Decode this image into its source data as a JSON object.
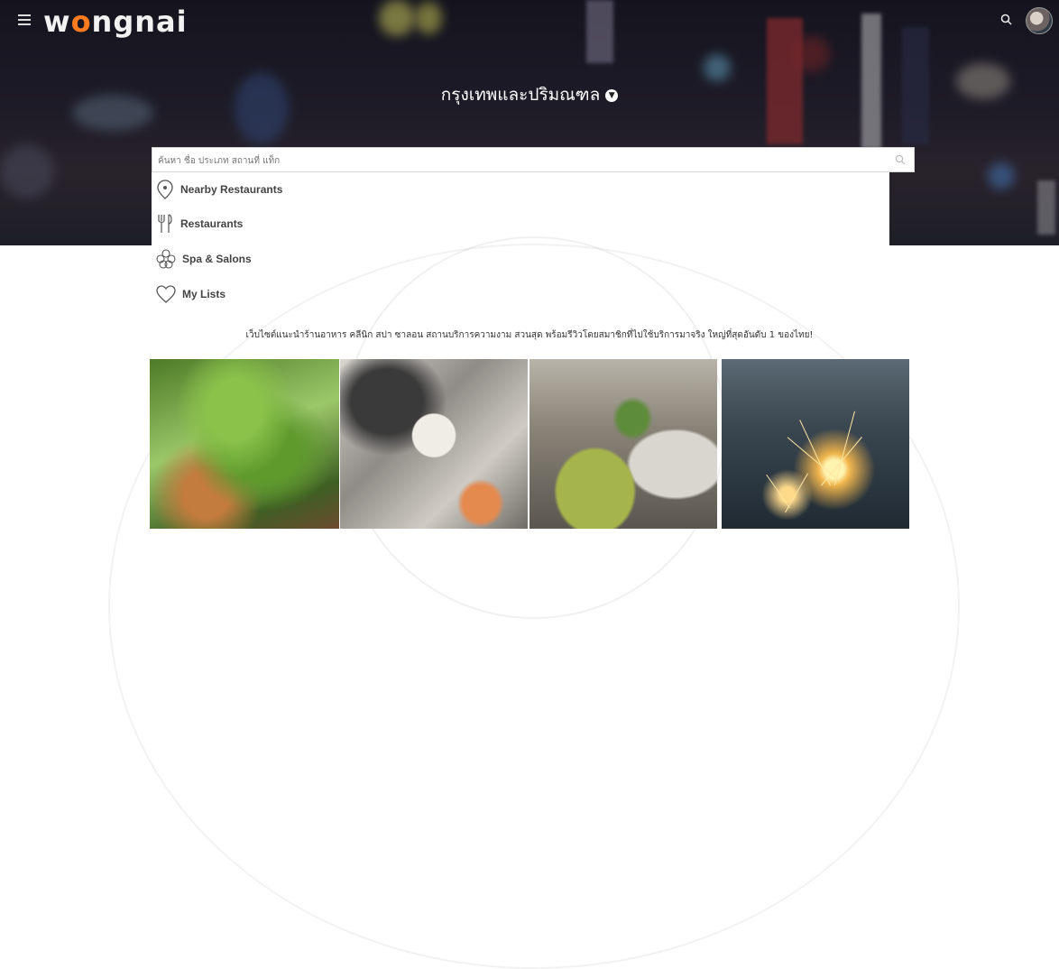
{
  "header": {
    "logo": {
      "prefix": "w",
      "accent": "o",
      "suffix": "ngnai"
    },
    "location": "กรุงเทพและปริมณฑล",
    "menu_icon": "hamburger-icon",
    "search_icon": "search-icon",
    "avatar": "user-avatar"
  },
  "search": {
    "placeholder": "ค้นหา ชื่อ ประเภท สถานที่ แท็ก",
    "suggestions": [
      {
        "label": "Nearby Restaurants",
        "icon": "location-pin-icon"
      },
      {
        "label": "Restaurants",
        "icon": "fork-knife-icon"
      },
      {
        "label": "Spa & Salons",
        "icon": "flower-icon"
      },
      {
        "label": "My Lists",
        "icon": "heart-icon"
      }
    ]
  },
  "tagline": "เว็บไซต์แนะนำร้านอาหาร คลีนิก สปา ซาลอน สถานบริการความงาม สวนสุด พร้อมรีวิวโดยสมาชิกที่ไปใช้บริการมาจริง ใหญ่ที่สุดอันดับ 1 ของไทย!",
  "colors": {
    "brand": "#ff7c1e",
    "hero_text": "#ffffff"
  }
}
